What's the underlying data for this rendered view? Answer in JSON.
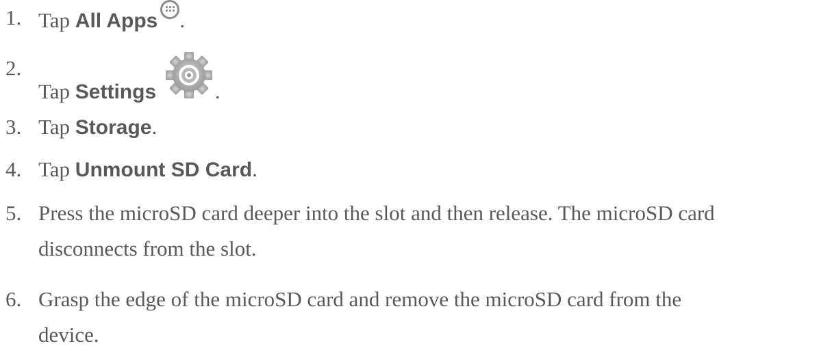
{
  "steps": [
    {
      "number": "1.",
      "prefix": "Tap ",
      "bold": "All Apps",
      "suffix": ".",
      "icon": "all-apps-icon"
    },
    {
      "number": "2.",
      "prefix": "Tap ",
      "bold": "Settings",
      "suffix": ".",
      "icon": "settings-gear-icon"
    },
    {
      "number": "3.",
      "prefix": "Tap ",
      "bold": "Storage",
      "suffix": "."
    },
    {
      "number": "4.",
      "prefix": "Tap ",
      "bold": "Unmount SD Card",
      "suffix": "."
    },
    {
      "number": "5.",
      "line1": "Press the microSD card deeper into the slot and then release. The microSD card",
      "line2": "disconnects from the slot."
    },
    {
      "number": "6.",
      "line1": "Grasp the edge of the microSD card and remove the microSD card from the",
      "line2": "device."
    }
  ],
  "colors": {
    "text": "#595959",
    "icon": "#8a8a8a"
  }
}
